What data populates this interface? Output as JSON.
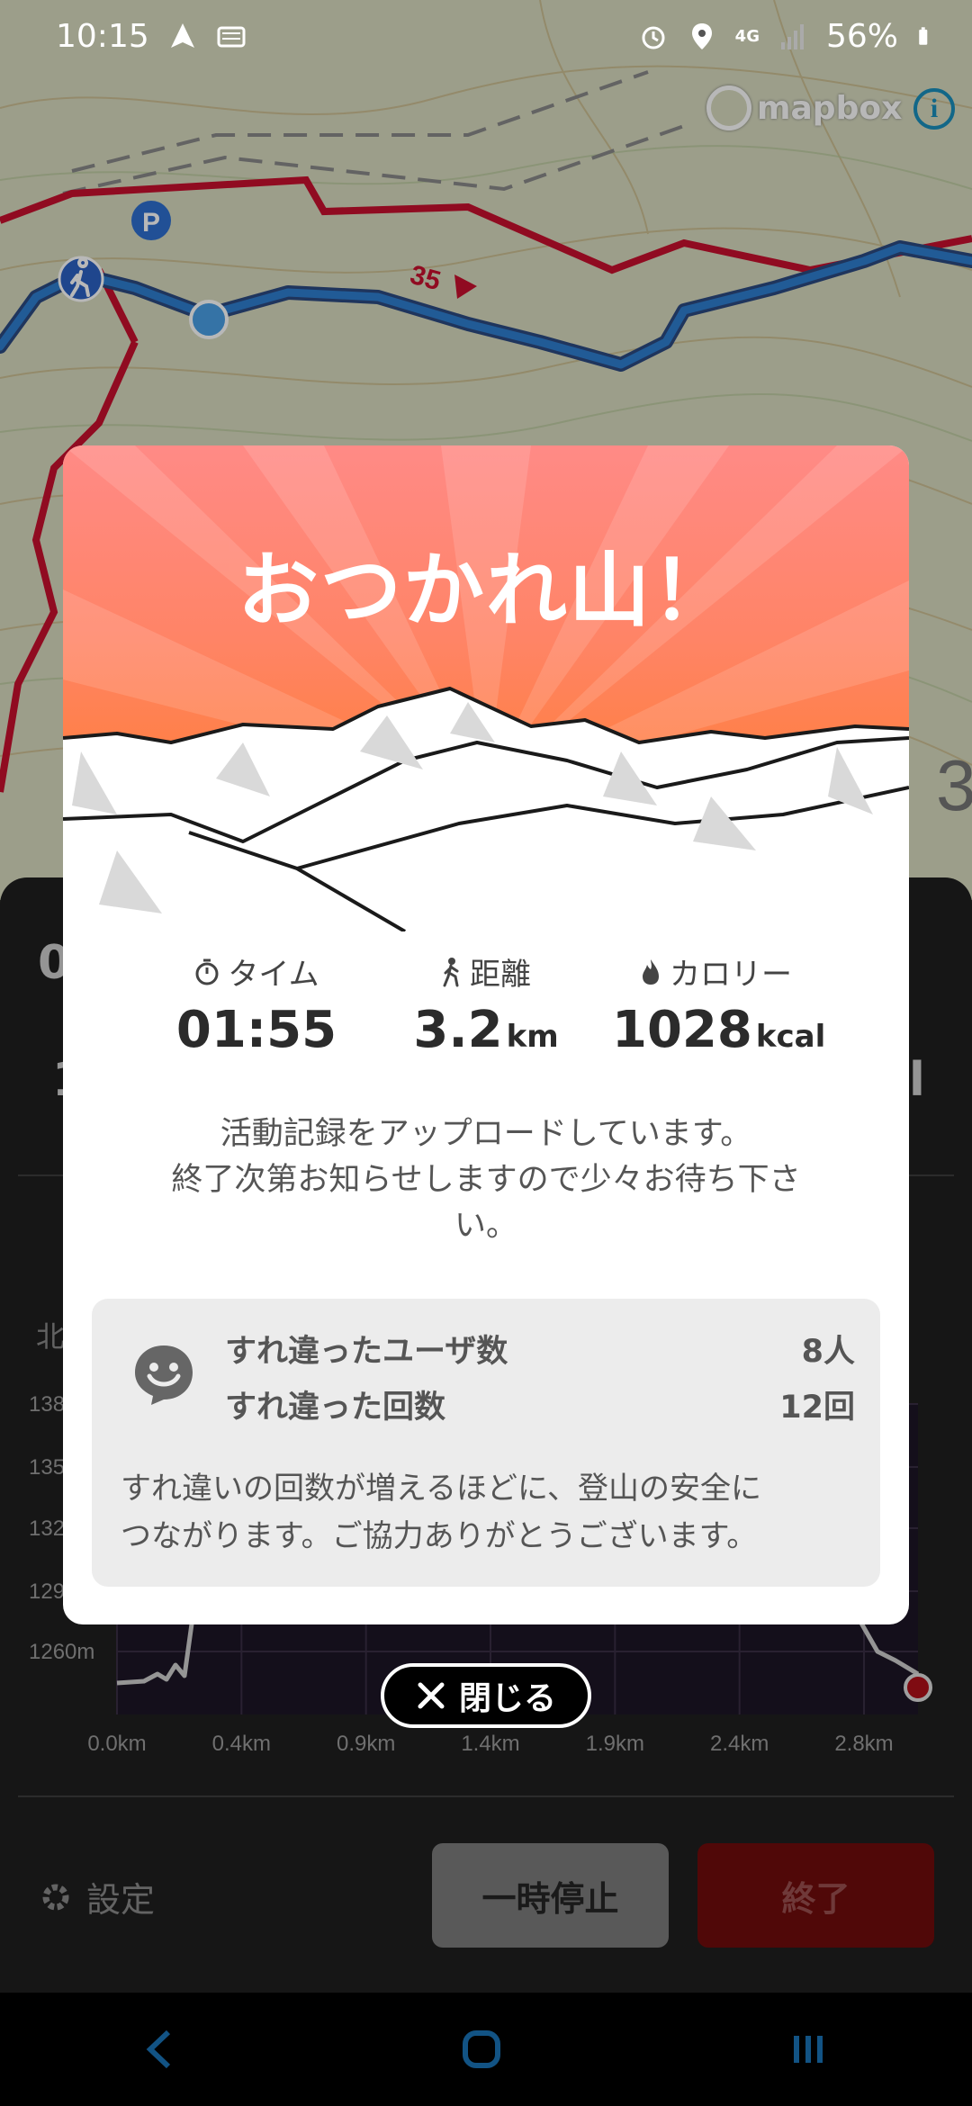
{
  "status_bar": {
    "time": "10:15",
    "network": "4G",
    "battery": "56%"
  },
  "map": {
    "attribution": "mapbox",
    "route_marker_label": "35",
    "parking_label": "P",
    "peek_number": "3"
  },
  "panel": {
    "peek_left_top": "0",
    "peek_left_mid": "1",
    "peek_right_mid": "l",
    "chart_direction_label": "北"
  },
  "chart_data": {
    "type": "area",
    "x_ticks": [
      "0.0km",
      "0.4km",
      "0.9km",
      "1.4km",
      "1.9km",
      "2.4km",
      "2.8km"
    ],
    "y_ticks": [
      "1260m",
      "129",
      "132",
      "135",
      "138"
    ],
    "xlim": [
      0.0,
      3.0
    ],
    "ylim": [
      1250,
      1390
    ]
  },
  "controls": {
    "settings": "設定",
    "pause": "一時停止",
    "end": "終了"
  },
  "modal": {
    "title": "おつかれ山！",
    "stats": {
      "time_label": "タイム",
      "time_value": "01:55",
      "distance_label": "距離",
      "distance_value": "3.2",
      "distance_unit": "km",
      "calorie_label": "カロリー",
      "calorie_value": "1028",
      "calorie_unit": "kcal"
    },
    "upload_line1": "活動記録をアップロードしています。",
    "upload_line2": "終了次第お知らせしますので少々お待ち下さ",
    "upload_line3": "い。",
    "encounter": {
      "users_label": "すれ違ったユーザ数",
      "users_value": "8人",
      "count_label": "すれ違った回数",
      "count_value": "12回",
      "note_line1": "すれ違いの回数が増えるほどに、登山の安全に",
      "note_line2": "つながります。ご協力ありがとうございます。"
    }
  },
  "close_button": {
    "label": "閉じる"
  },
  "colors": {
    "accent_red": "#d0021b",
    "route_blue": "#1565a8",
    "hero_top": "#ff8a86",
    "hero_bottom": "#ff7a28"
  }
}
